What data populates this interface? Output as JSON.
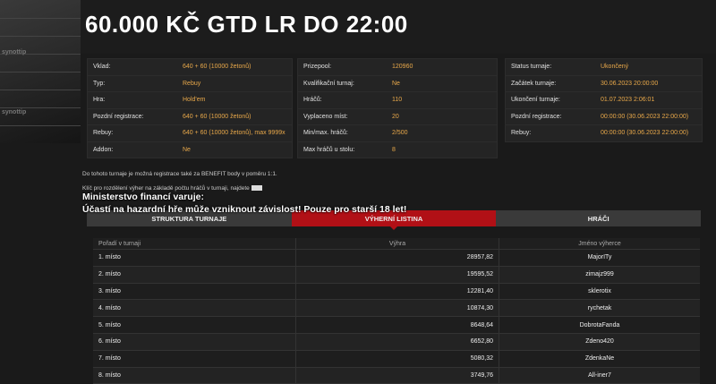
{
  "page_title": "60.000 KČ GTD LR DO 22:00",
  "brand": "synottip",
  "info_left": [
    {
      "label": "Vklad:",
      "value": "640 + 60 (10000 žetonů)"
    },
    {
      "label": "Typ:",
      "value": "Rebuy"
    },
    {
      "label": "Hra:",
      "value": "Hold'em"
    },
    {
      "label": "Pozdní registrace:",
      "value": "640 + 60 (10000 žetonů)"
    },
    {
      "label": "Rebuy:",
      "value": "640 + 60 (10000 žetonů), max 9999x"
    },
    {
      "label": "Addon:",
      "value": "Ne"
    }
  ],
  "info_mid": [
    {
      "label": "Prizepool:",
      "value": "120960"
    },
    {
      "label": "Kvalifikační turnaj:",
      "value": "Ne"
    },
    {
      "label": "Hráčů:",
      "value": "110"
    },
    {
      "label": "Vyplaceno míst:",
      "value": "20"
    },
    {
      "label": "Min/max. hráčů:",
      "value": "2/500"
    },
    {
      "label": "Max hráčů u stolu:",
      "value": "8"
    }
  ],
  "info_right": [
    {
      "label": "Status turnaje:",
      "value": "Ukončený"
    },
    {
      "label": "Začátek turnaje:",
      "value": "30.06.2023 20:00:00"
    },
    {
      "label": "Ukončení turnaje:",
      "value": "01.07.2023 2:06:01"
    },
    {
      "label": "Pozdní registrace:",
      "value": "00:00:00 (30.06.2023 22:00:00)"
    },
    {
      "label": "Rebuy:",
      "value": "00:00:00 (30.06.2023 22:00:00)"
    }
  ],
  "note1": "Do tohoto turnaje je možná registrace také za BENEFIT body v poměru 1:1.",
  "note2": "Klíč pro rozdělení výher na základě počtu hráčů v turnaji, najdete",
  "warning1": "Ministerstvo financí varuje:",
  "warning2": "Účastí na hazardní hře může vzniknout závislost! Pouze pro starší 18 let!",
  "tabs": [
    "STRUKTURA TURNAJE",
    "VÝHERNÍ LISTINA",
    "HRÁČI"
  ],
  "table": {
    "headers": [
      "Pořadí v turnaji",
      "Výhra",
      "Jméno výherce"
    ],
    "rows": [
      [
        "1. místo",
        "28957,82",
        "MajorITy"
      ],
      [
        "2. místo",
        "19595,52",
        "zimajz999"
      ],
      [
        "3. místo",
        "12281,40",
        "sklerotix"
      ],
      [
        "4. místo",
        "10874,30",
        "rychetak"
      ],
      [
        "5. místo",
        "8648,64",
        "DobrotaFanda"
      ],
      [
        "6. místo",
        "6652,80",
        "Zdeno420"
      ],
      [
        "7. místo",
        "5080,32",
        "ZdenkaNe"
      ],
      [
        "8. místo",
        "3749,76",
        "All-iner7"
      ]
    ]
  }
}
